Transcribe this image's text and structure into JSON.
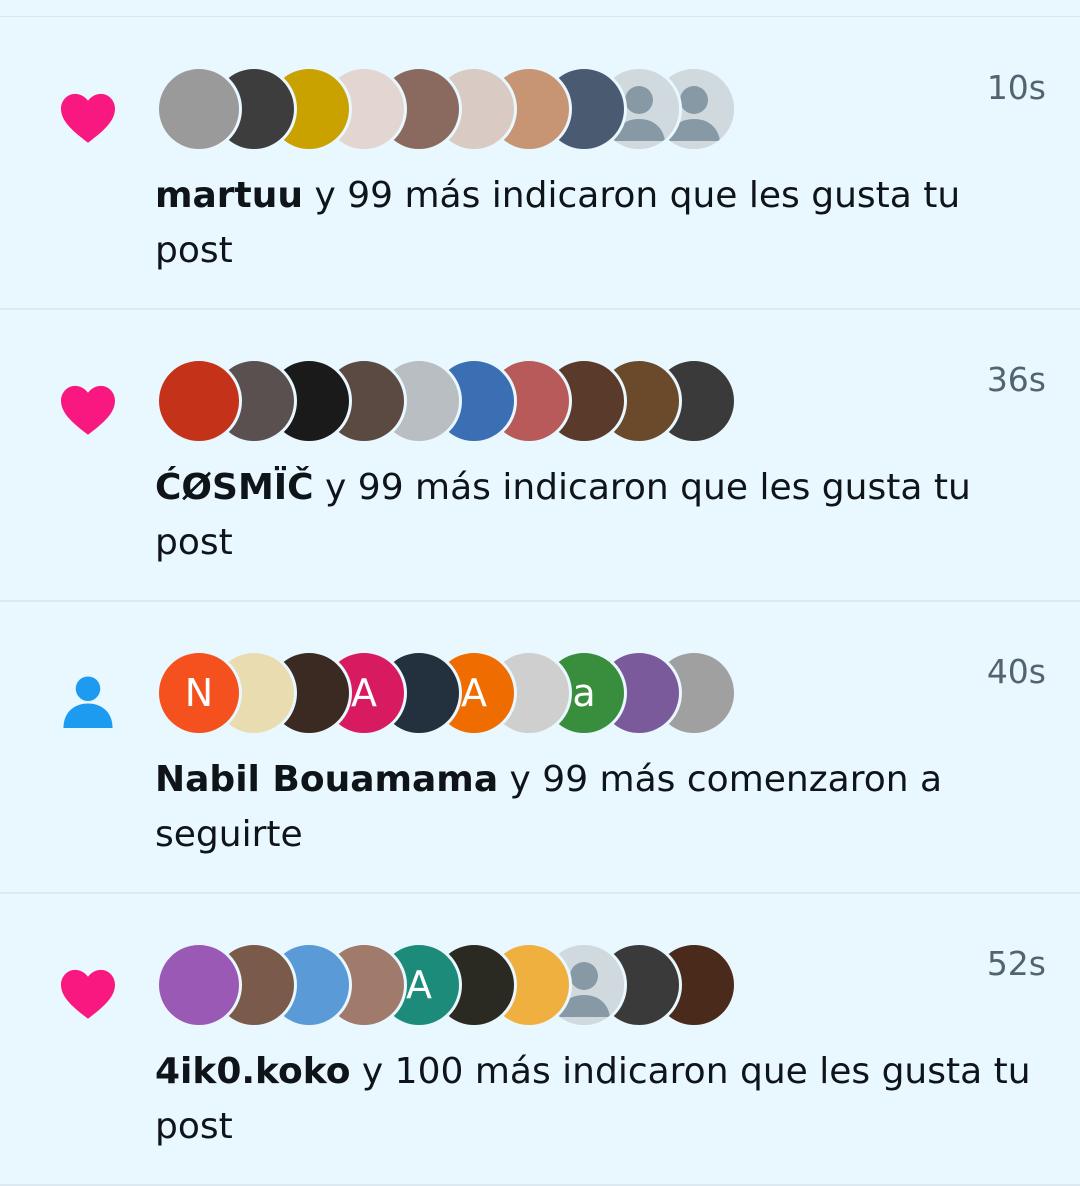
{
  "notifications": [
    {
      "type": "like",
      "icon": "heart-icon",
      "icon_color": "#f91880",
      "time": "10s",
      "name": "martuu",
      "message": " y 99 más indicaron que les gusta tu post",
      "avatars": [
        {
          "color": "#9a9a9a"
        },
        {
          "color": "#3d3d3d"
        },
        {
          "color": "#c9a200"
        },
        {
          "color": "#e3d5cf"
        },
        {
          "color": "#8a6a5e"
        },
        {
          "color": "#d9cbc3"
        },
        {
          "color": "#c79574"
        },
        {
          "color": "#4a5a70"
        },
        {
          "color": "#cfd9de",
          "placeholder": true
        },
        {
          "color": "#cfd9de",
          "placeholder": true
        }
      ]
    },
    {
      "type": "like",
      "icon": "heart-icon",
      "icon_color": "#f91880",
      "time": "36s",
      "name": "ĆØSMÏČ",
      "message": " y 99 más indicaron que les gusta tu post",
      "avatars": [
        {
          "color": "#c4321a"
        },
        {
          "color": "#5a5050"
        },
        {
          "color": "#1a1a1a"
        },
        {
          "color": "#5a4a42"
        },
        {
          "color": "#b8bec2"
        },
        {
          "color": "#3a6fb3"
        },
        {
          "color": "#b85a5a"
        },
        {
          "color": "#5a3a2a"
        },
        {
          "color": "#6a4a2a"
        },
        {
          "color": "#3a3a3a"
        }
      ]
    },
    {
      "type": "follow",
      "icon": "person-icon",
      "icon_color": "#1d9bf0",
      "time": "40s",
      "name": "Nabil Bouamama",
      "message": " y 99 más comenzaron a seguirte",
      "avatars": [
        {
          "color": "#f4511e",
          "letter": "N"
        },
        {
          "color": "#e9dcb0"
        },
        {
          "color": "#3a2a22"
        },
        {
          "color": "#d81b60",
          "letter": "A"
        },
        {
          "color": "#23303e"
        },
        {
          "color": "#ef6c00",
          "letter": "A"
        },
        {
          "color": "#cfcfcf"
        },
        {
          "color": "#388e3c",
          "letter": "a"
        },
        {
          "color": "#7a5a9a"
        },
        {
          "color": "#a0a0a0"
        }
      ]
    },
    {
      "type": "like",
      "icon": "heart-icon",
      "icon_color": "#f91880",
      "time": "52s",
      "name": "4ik0.koko",
      "message": " y 100 más indicaron que les gusta tu post",
      "avatars": [
        {
          "color": "#9b59b6"
        },
        {
          "color": "#7a5a4a"
        },
        {
          "color": "#5a9ad6"
        },
        {
          "color": "#a07a6a"
        },
        {
          "color": "#1d8b7a",
          "letter": "A"
        },
        {
          "color": "#2a2a22"
        },
        {
          "color": "#f0b040"
        },
        {
          "color": "#cfd9de",
          "placeholder": true
        },
        {
          "color": "#3a3a3a"
        },
        {
          "color": "#4a2a1a"
        }
      ]
    }
  ]
}
